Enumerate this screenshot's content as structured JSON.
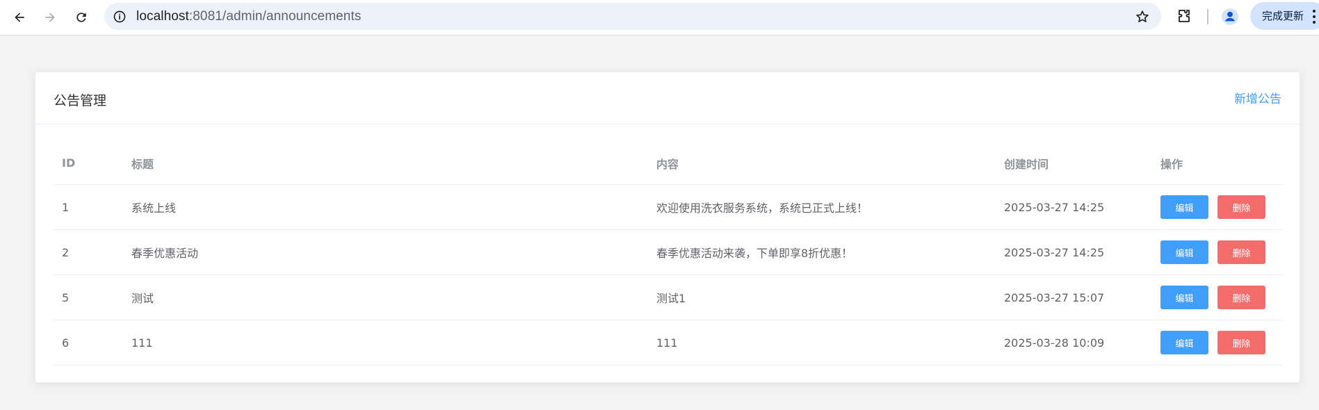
{
  "browser": {
    "url_host": "localhost",
    "url_path": ":8081/admin/announcements",
    "update_label": "完成更新"
  },
  "page": {
    "title": "公告管理",
    "add_label": "新增公告"
  },
  "table": {
    "headers": {
      "id": "ID",
      "title": "标题",
      "content": "内容",
      "created": "创建时间",
      "actions": "操作"
    },
    "rows": [
      {
        "id": "1",
        "title": "系统上线",
        "content": "欢迎使用洗衣服务系统，系统已正式上线！",
        "created": "2025-03-27 14:25"
      },
      {
        "id": "2",
        "title": "春季优惠活动",
        "content": "春季优惠活动来袭，下单即享8折优惠！",
        "created": "2025-03-27 14:25"
      },
      {
        "id": "5",
        "title": "测试",
        "content": "测试1",
        "created": "2025-03-27 15:07"
      },
      {
        "id": "6",
        "title": "111",
        "content": "111",
        "created": "2025-03-28 10:09"
      }
    ],
    "edit_label": "编辑",
    "delete_label": "删除"
  },
  "colors": {
    "primary": "#409eff",
    "danger": "#f56c6c",
    "header_text": "#909399",
    "body_text": "#606266"
  },
  "icons": [
    "back-arrow-icon",
    "forward-arrow-icon",
    "reload-icon",
    "site-info-icon",
    "bookmark-star-icon",
    "extensions-puzzle-icon",
    "profile-avatar-icon",
    "more-menu-icon"
  ]
}
